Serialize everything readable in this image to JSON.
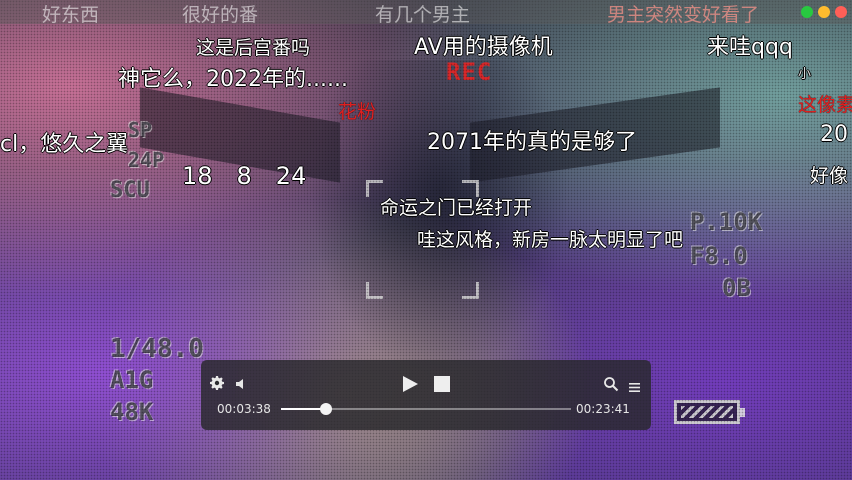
{
  "danmaku": {
    "d1": "好东西",
    "d2": "很好的番",
    "d3": "有几个男主",
    "d4": "男主突然变好看了",
    "d5": "这是后宫番吗",
    "d6": "AV用的摄像机",
    "d7": "来哇qqq",
    "d8": "神它么，2022年的......",
    "d9": "小",
    "d10": "花粉",
    "d11": "这像素",
    "d12": "cl，悠久之翼",
    "d13": "2071年的真的是够了",
    "d14": "20",
    "d15": "18　8　24",
    "d16": "好像",
    "d17": "命运之门已经打开",
    "d18": "哇这风格，新房一脉太明显了吧"
  },
  "camera_hud": {
    "rec": "REC",
    "sp": "SP",
    "fps": "24P",
    "mode": "SCU",
    "shutter": "1/48.0",
    "gain": "A1G",
    "wb": "48K",
    "iso": "P.10K",
    "aperture": "F8.0",
    "exposure": "0B"
  },
  "player": {
    "current_time": "00:03:38",
    "total_time": "00:23:41",
    "progress": 0.154,
    "icons": {
      "settings": "gear-icon",
      "volume": "speaker-icon",
      "play": "play-icon",
      "stop": "stop-icon",
      "search": "search-icon",
      "playlist": "list-icon"
    }
  },
  "window": {
    "close_color": "#ff5f57",
    "minimize_color": "#febc2e",
    "maximize_color": "#28c840"
  }
}
